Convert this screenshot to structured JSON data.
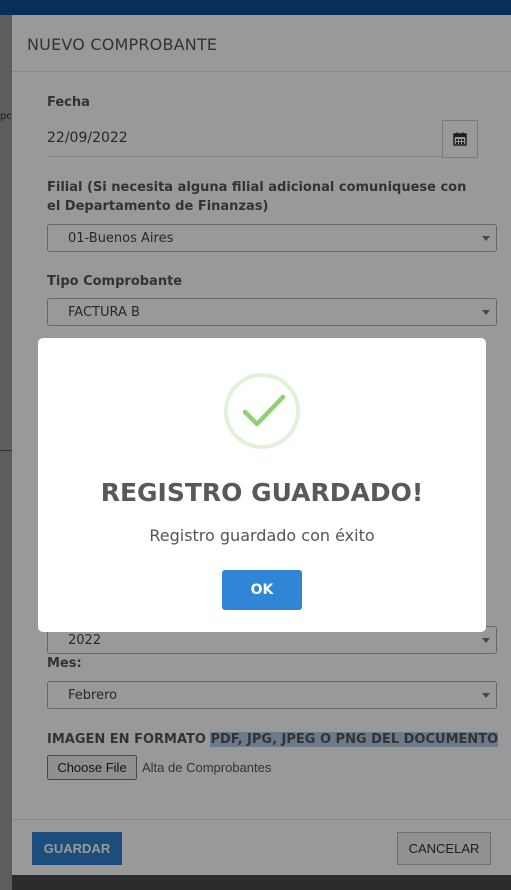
{
  "modal": {
    "title": "NUEVO COMPROBANTE",
    "fecha_label": "Fecha",
    "fecha_value": "22/09/2022",
    "filial_label": "Filial (Si necesita alguna filial adicional comuniquese con el Departamento de Finanzas)",
    "filial_value": "01-Buenos Aires",
    "tipo_label": "Tipo Comprobante",
    "tipo_value": "FACTURA B",
    "anio_value": "2022",
    "mes_label": "Mes:",
    "mes_value": "Febrero",
    "imagen_label_a": "IMAGEN EN FORMATO ",
    "imagen_label_b": "PDF, JPG, JPEG O PNG DEL DOCUMENTO",
    "file_button": "Choose File",
    "file_text": "Alta de Comprobantes",
    "save_label": "GUARDAR",
    "cancel_label": "CANCELAR"
  },
  "dialog": {
    "title": "REGISTRO GUARDADO!",
    "text": "Registro guardado con éxito",
    "ok_label": "OK"
  },
  "background": {
    "fragment": "pc"
  },
  "colors": {
    "topbar": "#0d4f93",
    "primary": "#3085d6",
    "success_ring": "#e1f2d9",
    "success_check": "#8dd26f"
  },
  "icons": {
    "calendar": "calendar-icon",
    "success": "check-icon"
  }
}
